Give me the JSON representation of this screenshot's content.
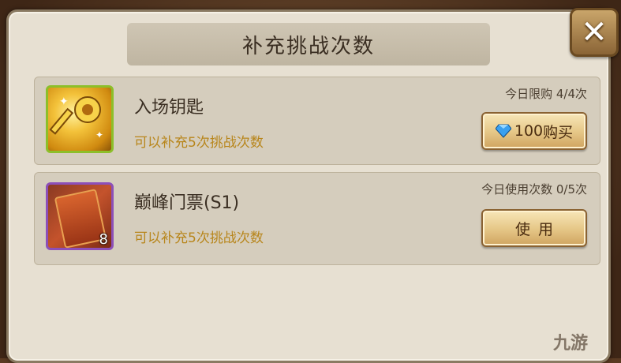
{
  "dialog": {
    "title": "补充挑战次数",
    "close_icon": "close-icon"
  },
  "items": [
    {
      "icon": "golden-key-icon",
      "name": "入场钥匙",
      "description": "可以补充5次挑战次数",
      "limit_text": "今日限购 4/4次",
      "button_price": "100",
      "button_label": "购买",
      "button_icon": "diamond-gem-icon"
    },
    {
      "icon": "ticket-card-icon",
      "name": "巅峰门票(S1)",
      "description": "可以补充5次挑战次数",
      "limit_text": "今日使用次数 0/5次",
      "count": "8",
      "button_label": "使用"
    }
  ],
  "watermark": "九游",
  "colors": {
    "description_gold": "#b8861c",
    "key_frame_green": "#8cbf2a",
    "ticket_frame_purple": "#8c4fb8",
    "gem_blue": "#3aa0f0"
  }
}
